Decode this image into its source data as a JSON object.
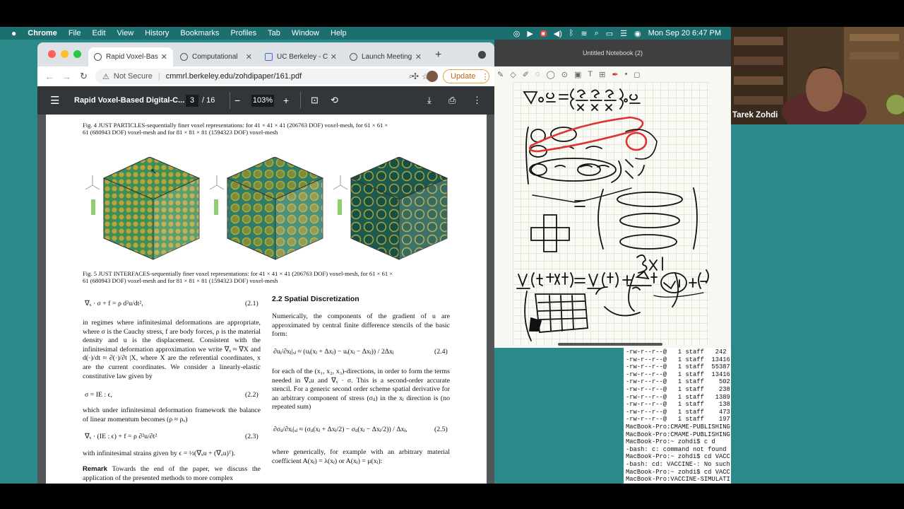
{
  "menubar": {
    "app": "Chrome",
    "items": [
      "File",
      "Edit",
      "View",
      "History",
      "Bookmarks",
      "Profiles",
      "Tab",
      "Window",
      "Help"
    ],
    "clock": "Mon Sep 20  6:47 PM"
  },
  "browser": {
    "tabs": [
      {
        "label": "Rapid Voxel-Bas"
      },
      {
        "label": "Computational"
      },
      {
        "label": "UC Berkeley - C"
      },
      {
        "label": "Launch Meeting"
      }
    ],
    "not_secure": "Not Secure",
    "url": "cmmrl.berkeley.edu/zohdipaper/161.pdf",
    "update_label": "Update"
  },
  "pdf": {
    "title": "Rapid Voxel-Based Digital-C...",
    "page_current": "3",
    "page_total": "/ 16",
    "zoom": "103%"
  },
  "paper": {
    "fig4_caption_1": "Fig.  4  JUST  PARTICLES-sequentially  finer  voxel  representations:  for  41 × 41 × 41 (206763 DOF)  voxel-mesh,  for  61 × 61 ×",
    "fig4_caption_2": "61 (680943 DOF) voxel-mesh and for 81 × 81 × 81 (1594323 DOF) voxel-mesh",
    "fig5_caption_1": "Fig.  5  JUST  INTERFACES-sequentially  finer  voxel  representations:  for  41 × 41 × 41 (206763 DOF)  voxel-mesh,  for  61 × 61 ×",
    "fig5_caption_2": "61 (680943 DOF) voxel-mesh and for 81 × 81 × 81 (1594323 DOF) voxel-mesh",
    "eq21": "∇ₓ · σ + f = ρ d²u/dt²,",
    "eq21_no": "(2.1)",
    "left_p1": "in regimes where infinitesimal deformations are appropriate, where σ is the Cauchy stress, f are body forces, ρ is the material density and u is the displacement. Consistent with the infinitesimal deformation approximation we write ∇ₓ ≈ ∇X and d(·)/dt ≈ ∂(·)/∂t |X, where X are the referential coordinates, x are the current coordinates. We consider a linearly-elastic constitutive law given by",
    "eq22": "σ = IE : ϵ,",
    "eq22_no": "(2.2)",
    "left_p2": "which under infinitesimal deformation framework the balance of linear momentum becomes (ρ ≈ ρₒ)",
    "eq23": "∇ₓ · (IE : ϵ) + f = ρ ∂²u/∂t²",
    "eq23_no": "(2.3)",
    "left_p3": "with infinitesimal strains given by ϵ = ½(∇ₓu + (∇ₓu)ᵀ).",
    "remark_label": "Remark",
    "remark_text": "Towards the end of the paper, we discuss the application of the presented methods to more complex",
    "section_title": "2.2  Spatial Discretization",
    "right_p1": "Numerically, the components of the gradient of u are approximated by central finite difference stencils of the basic form:",
    "eq24": "∂uᵢ/∂xⱼ|ₓⱼ ≈ (uᵢ(xⱼ + Δxⱼ) − uᵢ(xⱼ − Δxⱼ)) / 2Δxⱼ",
    "eq24_no": "(2.4)",
    "right_p2": "for each of the (x₁, x₂, x₃)-directions, in order to form the terms needed in ∇ₓu and ∇ₓ · σ. This is a second-order accurate stencil. For a generic second order scheme spatial derivative for an arbitrary component of stress (σᵢⱼ) in the xⱼ direction is (no repeated sum)",
    "eq25": "∂σᵢⱼ/∂xⱼ|ₓⱼ ≈ (σᵢⱼ(xⱼ + Δxⱼ/2) − σᵢⱼ(xⱼ − Δxⱼ/2)) / Δxⱼ,",
    "eq25_no": "(2.5)",
    "right_p3": "where generically, for example with an arbitrary material coefficient A(xⱼ) = λ(xⱼ) or A(xⱼ) = μ(xⱼ):"
  },
  "notebook": {
    "title": "Untitled Notebook (2)"
  },
  "terminal": {
    "lines": [
      "-rw-r--r--@   1 staff   242",
      "-rw-r--r--@   1 staff  13416",
      "-rw-r--r--@   1 staff  55387",
      "-rw-r--r--@   1 staff  13416",
      "-rw-r--r--@   1 staff    502",
      "-rw-r--r--@   1 staff    238",
      "-rw-r--r--@   1 staff   1389",
      "-rw-r--r--@   1 staff    138",
      "-rw-r--r--@   1 staff    473",
      "-rw-r--r--@   1 staff    197",
      "MacBook-Pro:CMAME-PUBLISHING",
      "MacBook-Pro:CMAME-PUBLISHING",
      "MacBook-Pro:~ zohdi$ c d",
      "-bash: c: command not found",
      "MacBook-Pro:~ zohdi$ cd VACC",
      "-bash: cd: VACCINE-: No such",
      "MacBook-Pro:~ zohdi$ cd VACC",
      "MacBook-Pro:VACCINE-SIMULATI"
    ]
  },
  "webcam": {
    "name": "Tarek Zohdi"
  }
}
